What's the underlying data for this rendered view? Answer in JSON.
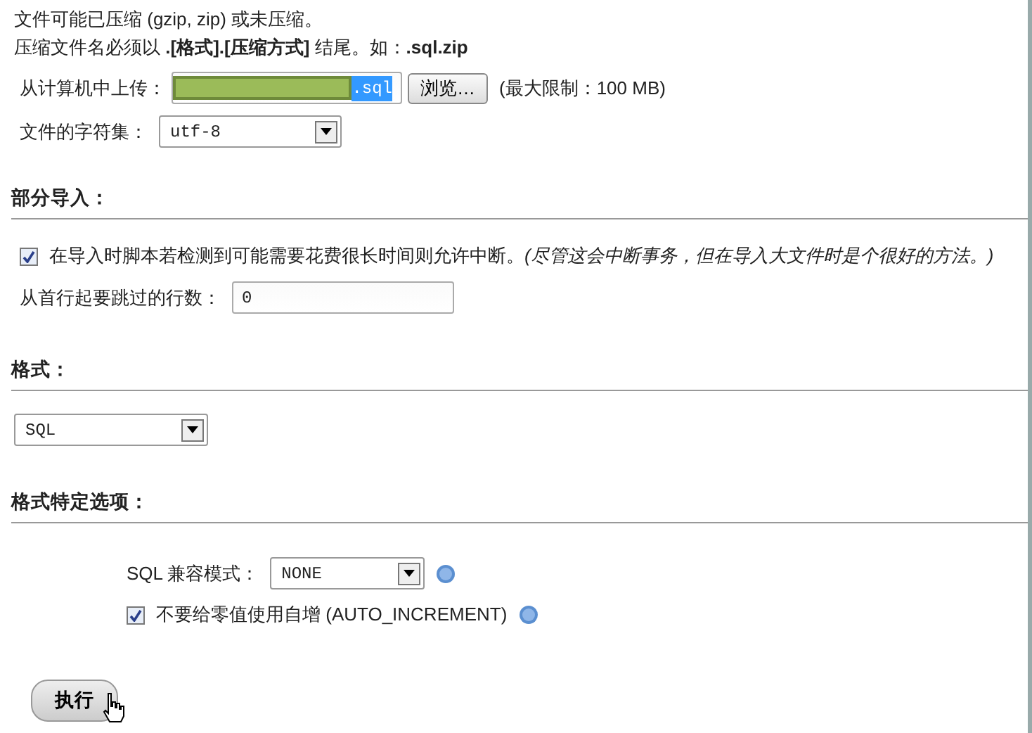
{
  "intro": [
    "文件可能已压缩 (gzip, zip) 或未压缩。",
    "压缩文件名必须以 **.[格式].[压缩方式]** 结尾。如：**.sql.zip**"
  ],
  "upload": {
    "label": "从计算机中上传：",
    "value": ".sql",
    "button": "浏览…",
    "limit": "(最大限制：100 MB)"
  },
  "charset": {
    "label": "文件的字符集：",
    "value": "utf-8"
  },
  "partial_import": {
    "heading": "部分导入：",
    "allow_interrupt": {
      "checked": true,
      "label": "在导入时脚本若检测到可能需要花费很长时间则允许中断。",
      "note": "(尽管这会中断事务，但在导入大文件时是个很好的方法。)"
    },
    "skip": {
      "label": "从首行起要跳过的行数：",
      "value": "0"
    }
  },
  "format": {
    "heading": "格式：",
    "value": "SQL"
  },
  "format_options": {
    "heading": "格式特定选项：",
    "compat": {
      "label": "SQL 兼容模式：",
      "value": "NONE"
    },
    "no_auto_value": {
      "checked": true,
      "label": "不要给零值使用自增 (AUTO_INCREMENT)"
    }
  },
  "submit": "执行"
}
